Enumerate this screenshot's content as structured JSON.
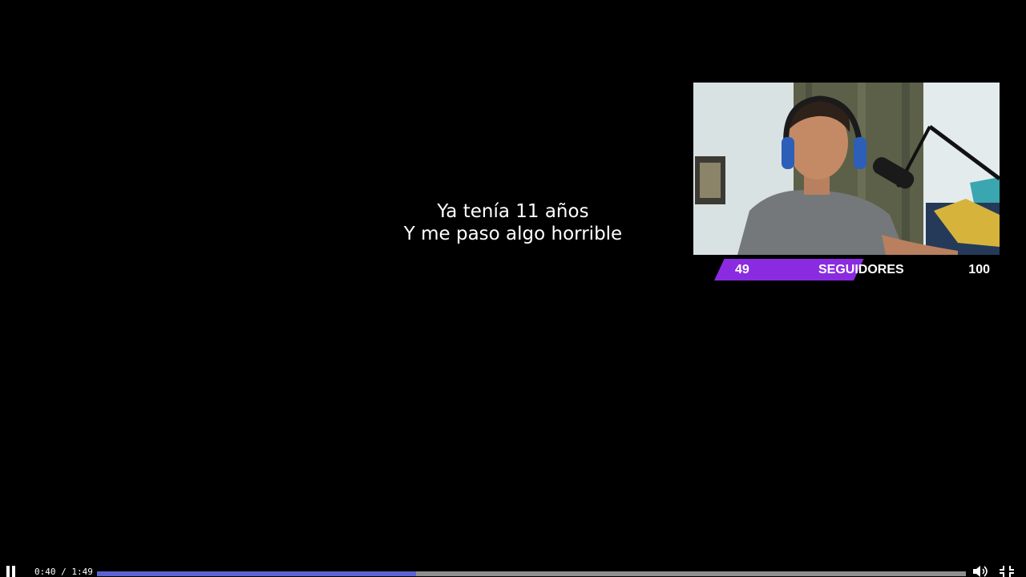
{
  "caption": {
    "line1": "Ya tenía 11 años",
    "line2": "Y me paso algo horrible"
  },
  "goal": {
    "current": "49",
    "label": "SEGUIDORES",
    "target": "100",
    "progress_fraction": 0.49,
    "color": "#8a2be2"
  },
  "controls": {
    "time": "0:40 / 1:49",
    "progress_fraction": 0.367,
    "progress_color": "#5b63d3",
    "play_state_icon": "pause-icon",
    "volume_icon": "volume-icon",
    "fullscreen_icon": "exit-fullscreen-icon"
  }
}
